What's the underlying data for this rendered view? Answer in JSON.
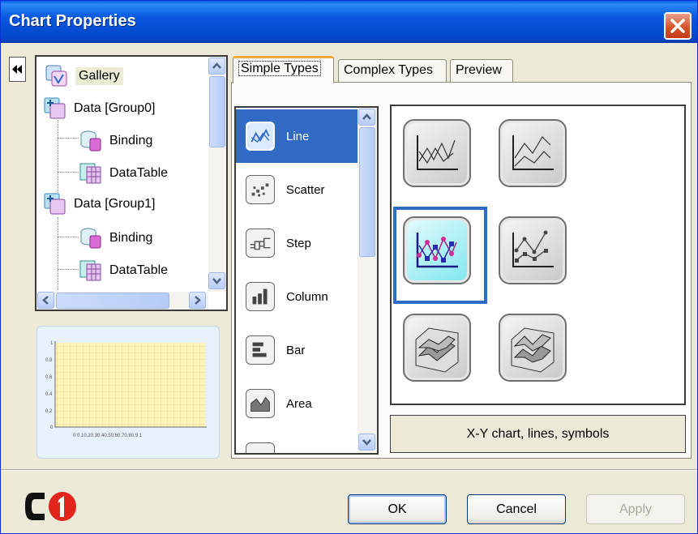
{
  "window": {
    "title": "Chart Properties",
    "accent": "#0858df",
    "close_color": "#d8532c"
  },
  "tree": {
    "items": [
      {
        "label": "Gallery",
        "icon": "gallery-icon",
        "selected": true
      },
      {
        "label": "Data [Group0]",
        "icon": "data-group-icon"
      },
      {
        "label": "Binding",
        "icon": "binding-icon"
      },
      {
        "label": "DataTable",
        "icon": "datatable-icon"
      },
      {
        "label": "Data [Group1]",
        "icon": "data-group-icon"
      },
      {
        "label": "Binding",
        "icon": "binding-icon"
      },
      {
        "label": "DataTable",
        "icon": "datatable-icon"
      }
    ]
  },
  "preview": {
    "y_ticks": [
      "1",
      "0.8",
      "0.6",
      "0.4",
      "0.2",
      "0"
    ],
    "x_ticks": "0 0.10.20.30.40.50.60.70.80.9 1"
  },
  "tabs": [
    {
      "label": "Simple Types",
      "active": true
    },
    {
      "label": "Complex Types"
    },
    {
      "label": "Preview"
    }
  ],
  "chart_types": [
    {
      "label": "Line",
      "icon": "line-chart-icon",
      "selected": true
    },
    {
      "label": "Scatter",
      "icon": "scatter-chart-icon"
    },
    {
      "label": "Step",
      "icon": "step-chart-icon"
    },
    {
      "label": "Column",
      "icon": "column-chart-icon"
    },
    {
      "label": "Bar",
      "icon": "bar-chart-icon"
    },
    {
      "label": "Area",
      "icon": "area-chart-icon"
    }
  ],
  "gallery": {
    "selected_index": 2,
    "description": "X-Y chart, lines, symbols"
  },
  "buttons": {
    "ok": "OK",
    "cancel": "Cancel",
    "apply": "Apply"
  },
  "logo": {
    "text": "C1"
  }
}
